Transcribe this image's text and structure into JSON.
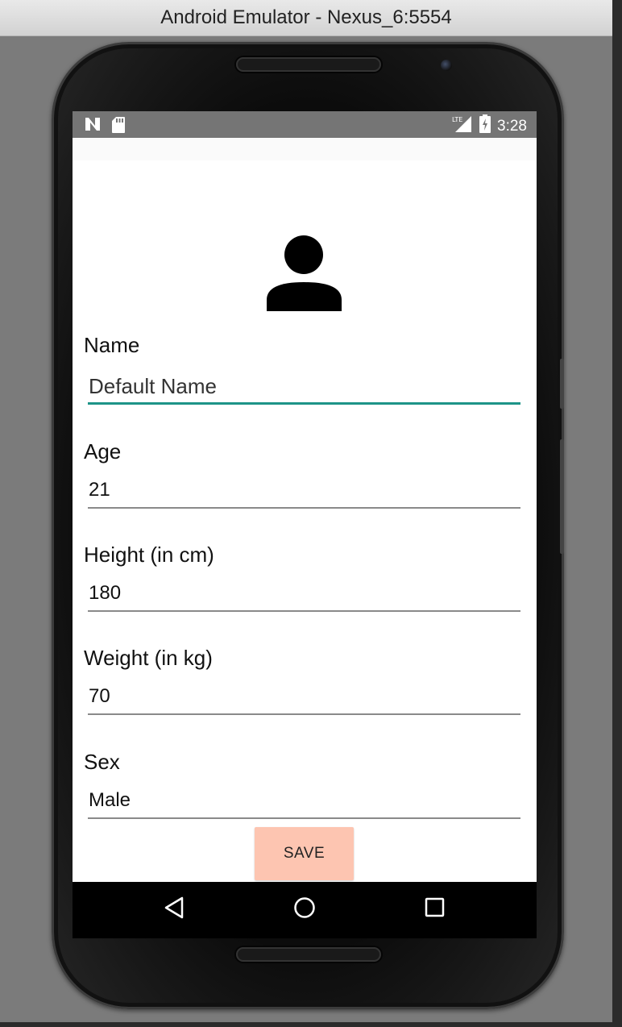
{
  "window": {
    "title": "Android Emulator - Nexus_6:5554"
  },
  "statusbar": {
    "left_icons": [
      "notification-n-icon",
      "sd-card-icon"
    ],
    "network": "LTE",
    "time": "3:28",
    "battery_icon": "battery-charging-icon"
  },
  "profile": {
    "avatar_icon": "person-icon"
  },
  "form": {
    "fields": [
      {
        "label": "Name",
        "value": "Default Name",
        "focused": true
      },
      {
        "label": "Age",
        "value": "21"
      },
      {
        "label": "Height (in cm)",
        "value": "180"
      },
      {
        "label": "Weight (in kg)",
        "value": "70"
      },
      {
        "label": "Sex",
        "value": "Male"
      }
    ],
    "save_label": "SAVE"
  },
  "navbar": {
    "buttons": [
      "back-icon",
      "home-icon",
      "recents-icon"
    ]
  },
  "colors": {
    "accent": "#1d9488",
    "save_button": "#fdc5b1",
    "statusbar": "#757575"
  }
}
